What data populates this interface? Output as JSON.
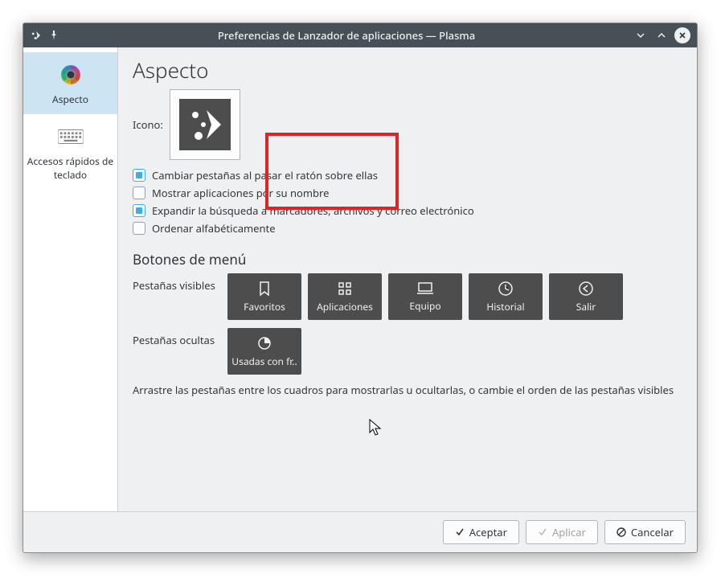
{
  "window": {
    "title": "Preferencias de Lanzador de aplicaciones — Plasma"
  },
  "sidebar": {
    "items": [
      {
        "label": "Aspecto"
      },
      {
        "label": "Accesos rápidos de teclado"
      }
    ]
  },
  "main": {
    "heading": "Aspecto",
    "icon_label": "Icono:",
    "checkboxes": [
      {
        "label": "Cambiar pestañas al pasar el ratón sobre ellas",
        "checked": true
      },
      {
        "label": "Mostrar aplicaciones por su nombre",
        "checked": false
      },
      {
        "label": "Expandir la búsqueda a marcadores, archivos y correo electrónico",
        "checked": true
      },
      {
        "label": "Ordenar alfabéticamente",
        "checked": false
      }
    ],
    "menu_section": "Botones de menú",
    "visible_label": "Pestañas visibles",
    "hidden_label": "Pestañas ocultas",
    "visible_tabs": [
      {
        "label": "Favoritos"
      },
      {
        "label": "Aplicaciones"
      },
      {
        "label": "Equipo"
      },
      {
        "label": "Historial"
      },
      {
        "label": "Salir"
      }
    ],
    "hidden_tabs": [
      {
        "label": "Usadas con fr.."
      }
    ],
    "drag_hint": "Arrastre las pestañas entre los cuadros para mostrarlas u ocultarlas, o cambie el orden de las pestañas visibles"
  },
  "buttons": {
    "ok": "Aceptar",
    "apply": "Aplicar",
    "cancel": "Cancelar"
  }
}
